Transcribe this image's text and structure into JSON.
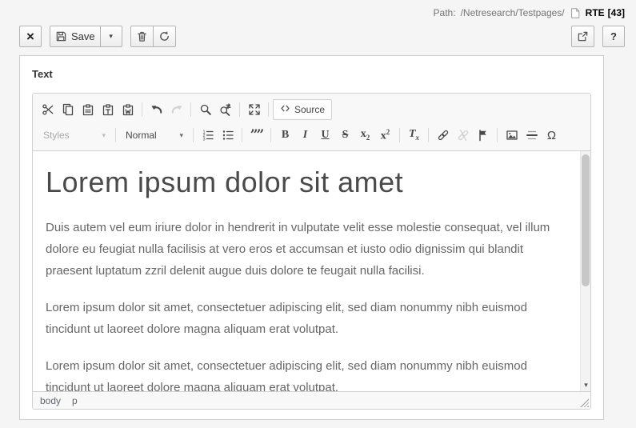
{
  "header": {
    "path_label": "Path:",
    "path_value": "/Netresearch/Testpages/",
    "record_title": "RTE",
    "record_uid": "[43]"
  },
  "docheader": {
    "save_label": "Save",
    "help_label": "?"
  },
  "field": {
    "label": "Text"
  },
  "icons": {
    "close": "×",
    "caret": "▾",
    "blockquote": "””",
    "bold": "B",
    "italic": "I",
    "underline": "U",
    "strikethrough": "S",
    "subscript_base": "x",
    "subscript_mark": "2",
    "superscript_base": "x",
    "superscript_mark": "2",
    "removeformat_base": "T",
    "removeformat_mark": "x",
    "specialchar": "Ω",
    "scroll_down": "▾"
  },
  "editor": {
    "styles_label": "Styles",
    "format_label": "Normal",
    "source_label": "Source",
    "content": {
      "heading": "Lorem ipsum dolor sit amet",
      "paragraphs": [
        "Duis autem vel eum iriure dolor in hendrerit in vulputate velit esse molestie consequat, vel illum dolore eu feugiat nulla facilisis at vero eros et accumsan et iusto odio dignissim qui blandit praesent luptatum zzril delenit augue duis dolore te feugait nulla facilisi.",
        "Lorem ipsum dolor sit amet, consectetuer adipiscing elit, sed diam nonummy nibh euismod tincidunt ut laoreet dolore magna aliquam erat volutpat.",
        "Lorem ipsum dolor sit amet, consectetuer adipiscing elit, sed diam nonummy nibh euismod tincidunt ut laoreet dolore magna aliquam erat volutpat."
      ]
    },
    "statusbar": {
      "elements": [
        "body",
        "p"
      ]
    }
  },
  "colors": {
    "toolbar_bg": "#f8f8f8",
    "chrome_border": "#d1d1d1",
    "panel_border": "#cccccc",
    "icon_gray": "#474747",
    "content_text": "#666666",
    "heading_text": "#4a4a4a"
  }
}
